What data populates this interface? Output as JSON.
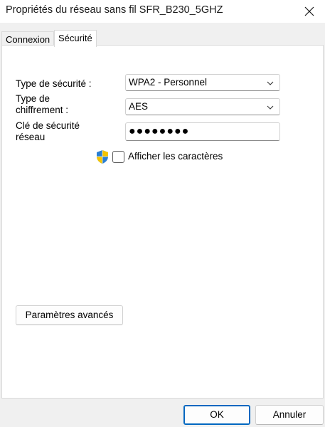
{
  "window": {
    "title": "Propriétés du réseau sans fil SFR_B230_5GHZ"
  },
  "tabs": [
    {
      "label": "Connexion"
    },
    {
      "label": "Sécurité"
    }
  ],
  "security": {
    "type_label": "Type de sécurité :",
    "type_value": "WPA2 - Personnel",
    "encryption_label_line1": "Type de",
    "encryption_label_line2": "chiffrement :",
    "encryption_value": "AES",
    "key_label_line1": "Clé de sécurité",
    "key_label_line2": "réseau",
    "key_value": "●●●●●●●●",
    "show_chars_label": "Afficher les caractères"
  },
  "buttons": {
    "advanced": "Paramètres avancés",
    "ok": "OK",
    "cancel": "Annuler"
  },
  "icons": {
    "close": "close-icon",
    "shield": "uac-shield-icon",
    "chevron": "chevron-down-icon"
  },
  "colors": {
    "accent": "#0067c0",
    "shield_blue": "#2a7fd4",
    "shield_yellow": "#f5c400"
  }
}
